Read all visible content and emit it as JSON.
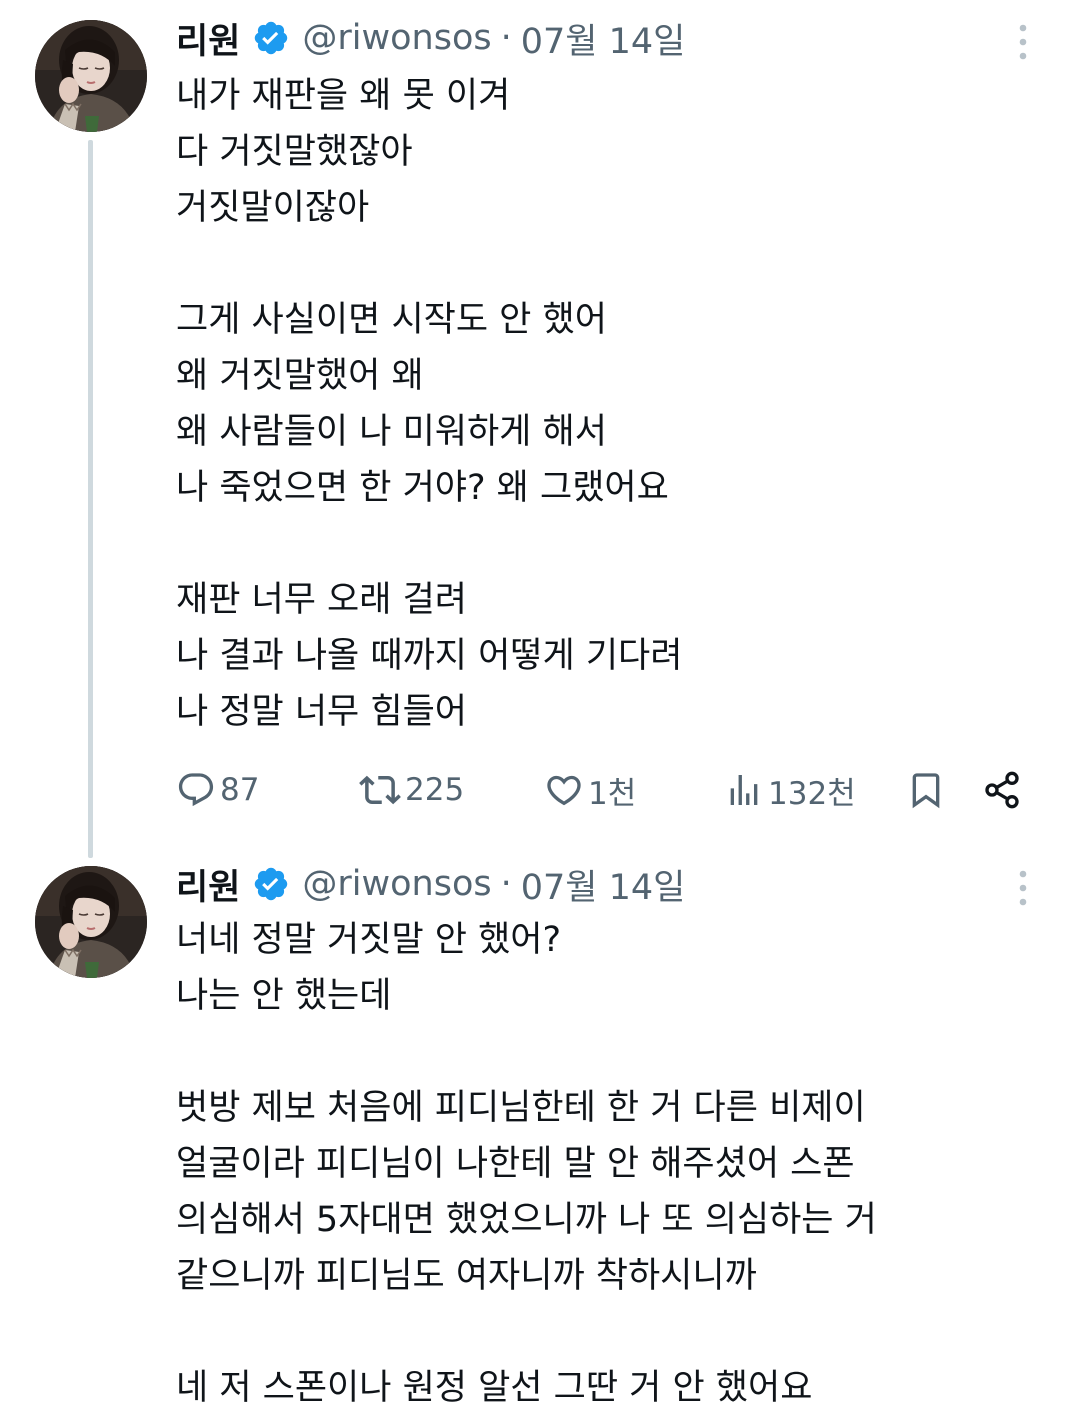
{
  "tweets": [
    {
      "author": {
        "name": "리원",
        "handle": "@riwonsos",
        "separator": "·",
        "date": "07월 14일"
      },
      "paragraphs": [
        [
          "내가 재판을 왜 못 이겨",
          "다 거짓말했잖아",
          "거짓말이잖아"
        ],
        [
          "그게 사실이면 시작도 안 했어",
          "왜 거짓말했어 왜",
          "왜 사람들이 나 미워하게 해서",
          "나 죽었으면 한 거야? 왜 그랬어요"
        ],
        [
          "재판 너무 오래 걸려",
          "나 결과 나올 때까지 어떻게 기다려",
          "나 정말 너무 힘들어"
        ]
      ],
      "stats": {
        "replies": "87",
        "retweets": "225",
        "likes": "1천",
        "views": "132천"
      }
    },
    {
      "author": {
        "name": "리원",
        "handle": "@riwonsos",
        "separator": "·",
        "date": "07월 14일"
      },
      "paragraphs": [
        [
          "너네 정말 거짓말 안 했어?",
          "나는 안 했는데"
        ],
        [
          "벗방 제보 처음에 피디님한테 한 거 다른 비제이",
          "얼굴이라 피디님이 나한테 말 안 해주셨어 스폰",
          "의심해서 5자대면 했었으니까 나 또 의심하는 거",
          "같으니까 피디님도 여자니까 착하시니까"
        ],
        [
          "네 저 스폰이나 원정 알선 그딴 거 안 했어요"
        ]
      ]
    }
  ],
  "icons": {
    "verified": "verified-badge-icon",
    "more": "more-vertical-icon",
    "reply": "reply-icon",
    "retweet": "retweet-icon",
    "like": "heart-icon",
    "views": "views-icon",
    "bookmark": "bookmark-icon",
    "share": "share-icon"
  },
  "colors": {
    "text": "#0f1419",
    "secondary": "#536471",
    "verified": "#1d9bf0",
    "thread_line": "#cfd9de"
  }
}
